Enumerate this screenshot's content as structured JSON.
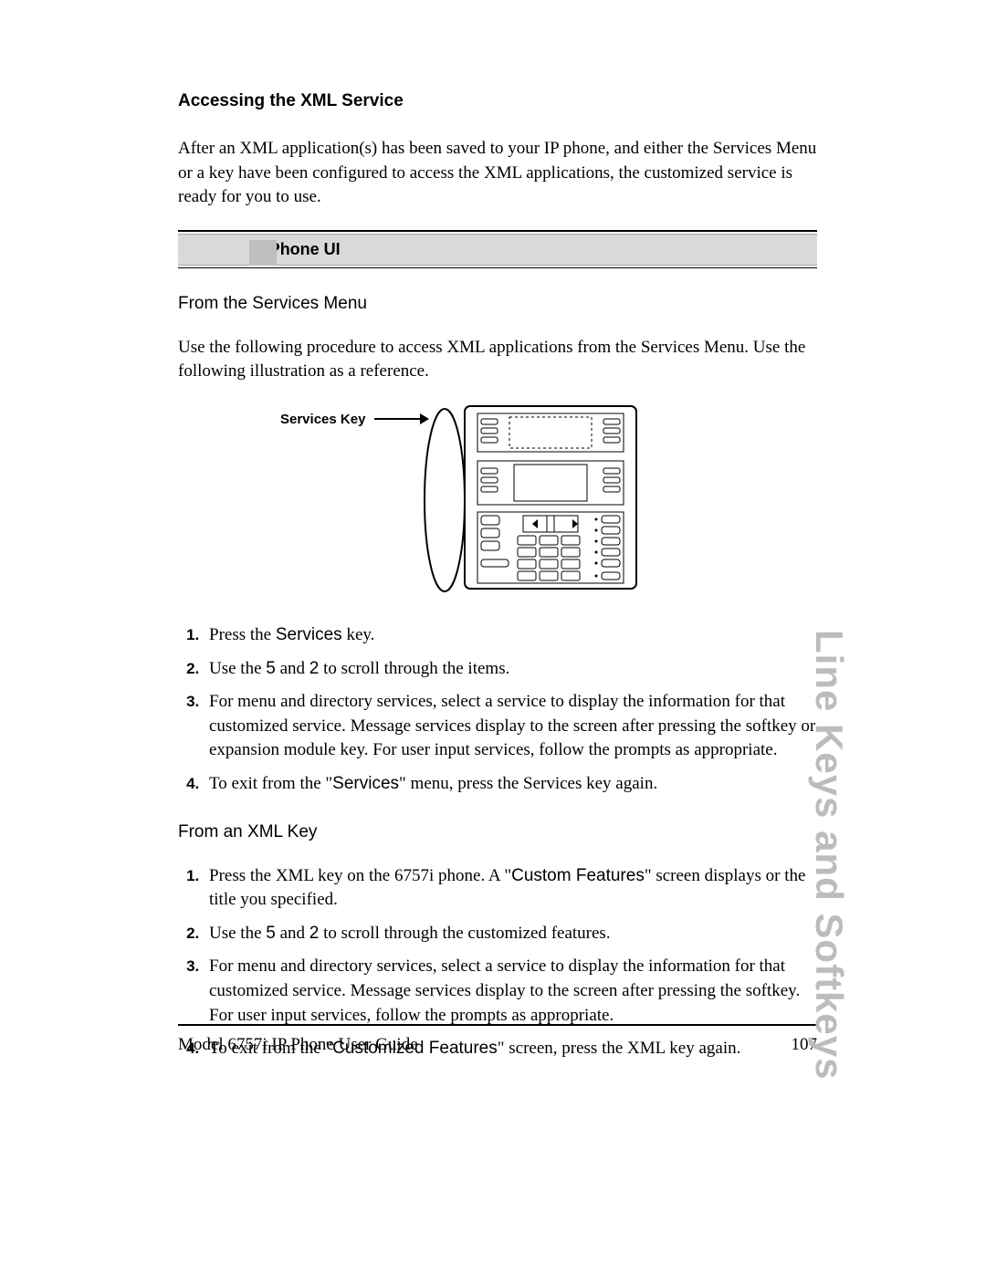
{
  "heading": "Accessing the XML Service",
  "intro": "After an XML application(s) has been saved to your IP phone, and either the Services Menu or a key have been configured to access the XML applications, the customized service is ready for you to use.",
  "banner": "IP Phone UI",
  "section1": {
    "title": "From the Services Menu",
    "lead": "Use the following procedure to access XML applications from the Services Menu. Use the following illustration as a reference.",
    "figure_label": "Services Key",
    "steps": [
      {
        "pre": "Press the ",
        "sf": "Services",
        "post": " key."
      },
      {
        "pre": "Use the ",
        "sf": "5",
        "mid": " and ",
        "sf2": "2",
        "post": " to scroll through the items."
      },
      {
        "text": "For menu and directory services, select a service to display the information for that customized service. Message services display to the screen after pressing the softkey or expansion module key. For user input services, follow the prompts as appropriate."
      },
      {
        "pre": "To exit from the \"",
        "sf": "Services",
        "post": "\" menu, press the Services key again."
      }
    ]
  },
  "section2": {
    "title": "From an XML Key",
    "steps": [
      {
        "pre": "Press the XML key on the 6757i phone. A \"",
        "sf": "Custom Features",
        "post": "\" screen displays or the title you specified."
      },
      {
        "pre": "Use the ",
        "sf": "5",
        "mid": " and ",
        "sf2": "2",
        "post": " to scroll through the customized features."
      },
      {
        "text": "For menu and directory services, select a service to display the information for that customized service. Message services display to the screen after pressing the softkey. For user input services, follow the prompts as appropriate."
      },
      {
        "pre": "To exit from the \"",
        "sf": "Customized Features",
        "post": "\" screen, press the XML key again."
      }
    ]
  },
  "footer": {
    "left": "Model 6757i IP Phone User Guide",
    "right": "107"
  },
  "side_tab": "Line Keys and Softkeys"
}
